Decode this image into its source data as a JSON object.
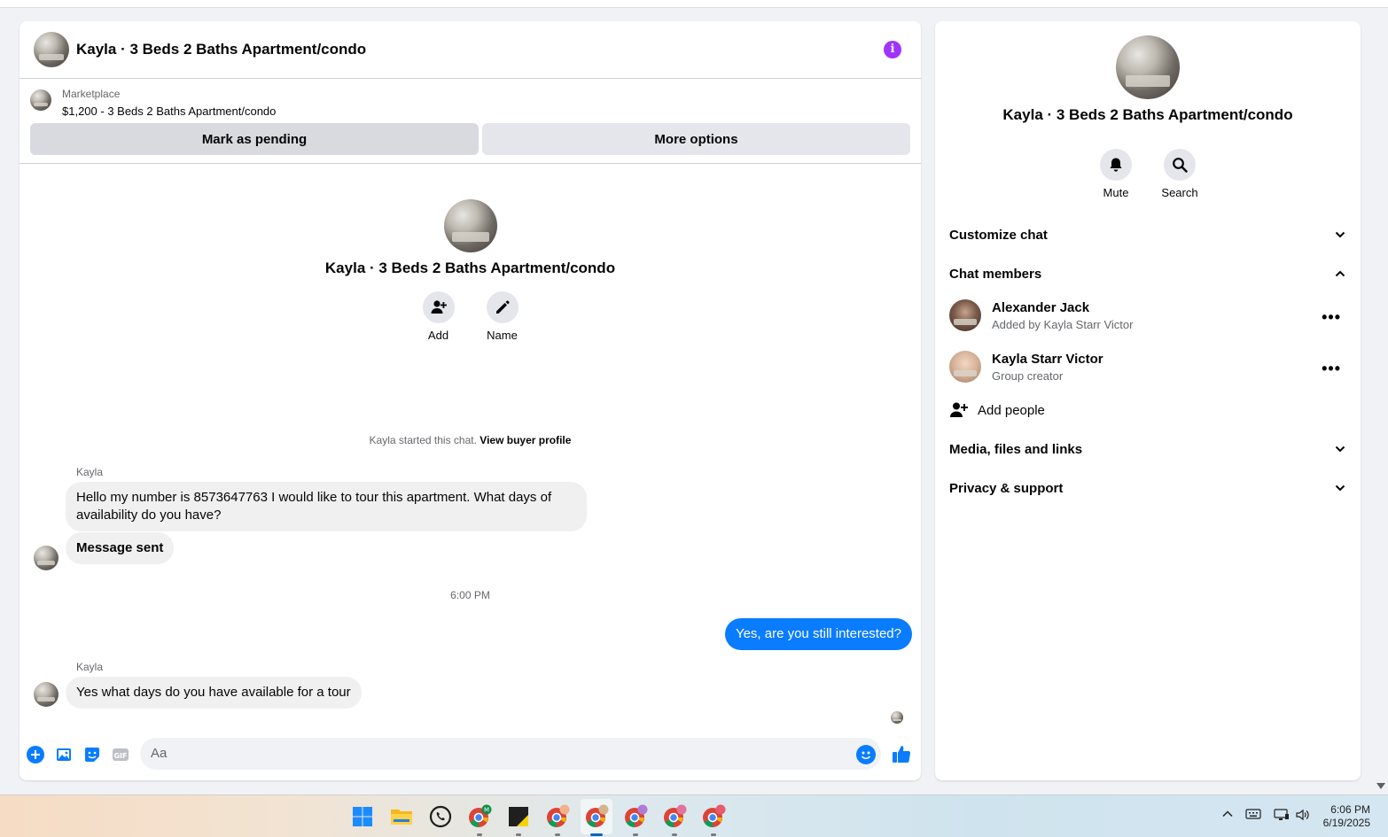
{
  "chat": {
    "title": "Kayla · 3 Beds 2 Baths Apartment/condo",
    "listing": {
      "source": "Marketplace",
      "title": "$1,200 - 3 Beds 2 Baths Apartment/condo"
    },
    "buttons": {
      "mark_pending": "Mark as pending",
      "more_options": "More options"
    },
    "intro": {
      "title": "Kayla · 3 Beds 2 Baths Apartment/condo",
      "add_label": "Add",
      "name_label": "Name"
    },
    "started_text": "Kayla started this chat.",
    "view_buyer_profile": "View buyer profile",
    "messages": [
      {
        "sender": "Kayla",
        "text": "Hello my number is 8573647763 I would like to tour this apartment. What days of availability do you have?"
      },
      {
        "text": "Message sent"
      },
      {
        "text": "Yes, are you still interested?"
      },
      {
        "sender": "Kayla",
        "text": "Yes what days do you have available for a tour"
      }
    ],
    "timestamp": "6:00 PM",
    "composer_placeholder": "Aa"
  },
  "side": {
    "title": "Kayla · 3 Beds 2 Baths Apartment/condo",
    "mute_label": "Mute",
    "search_label": "Search",
    "sections": {
      "customize": "Customize chat",
      "members": "Chat members",
      "media": "Media, files and links",
      "privacy": "Privacy & support"
    },
    "members": [
      {
        "name": "Alexander Jack",
        "subtitle": "Added by Kayla Starr Victor"
      },
      {
        "name": "Kayla Starr Victor",
        "subtitle": "Group creator"
      }
    ],
    "more_glyph": "•••",
    "add_people": "Add people"
  },
  "taskbar": {
    "time": "6:06 PM",
    "date": "6/19/2025",
    "colors": {
      "accent": "#0a7cff",
      "info": "#a033ff"
    }
  }
}
